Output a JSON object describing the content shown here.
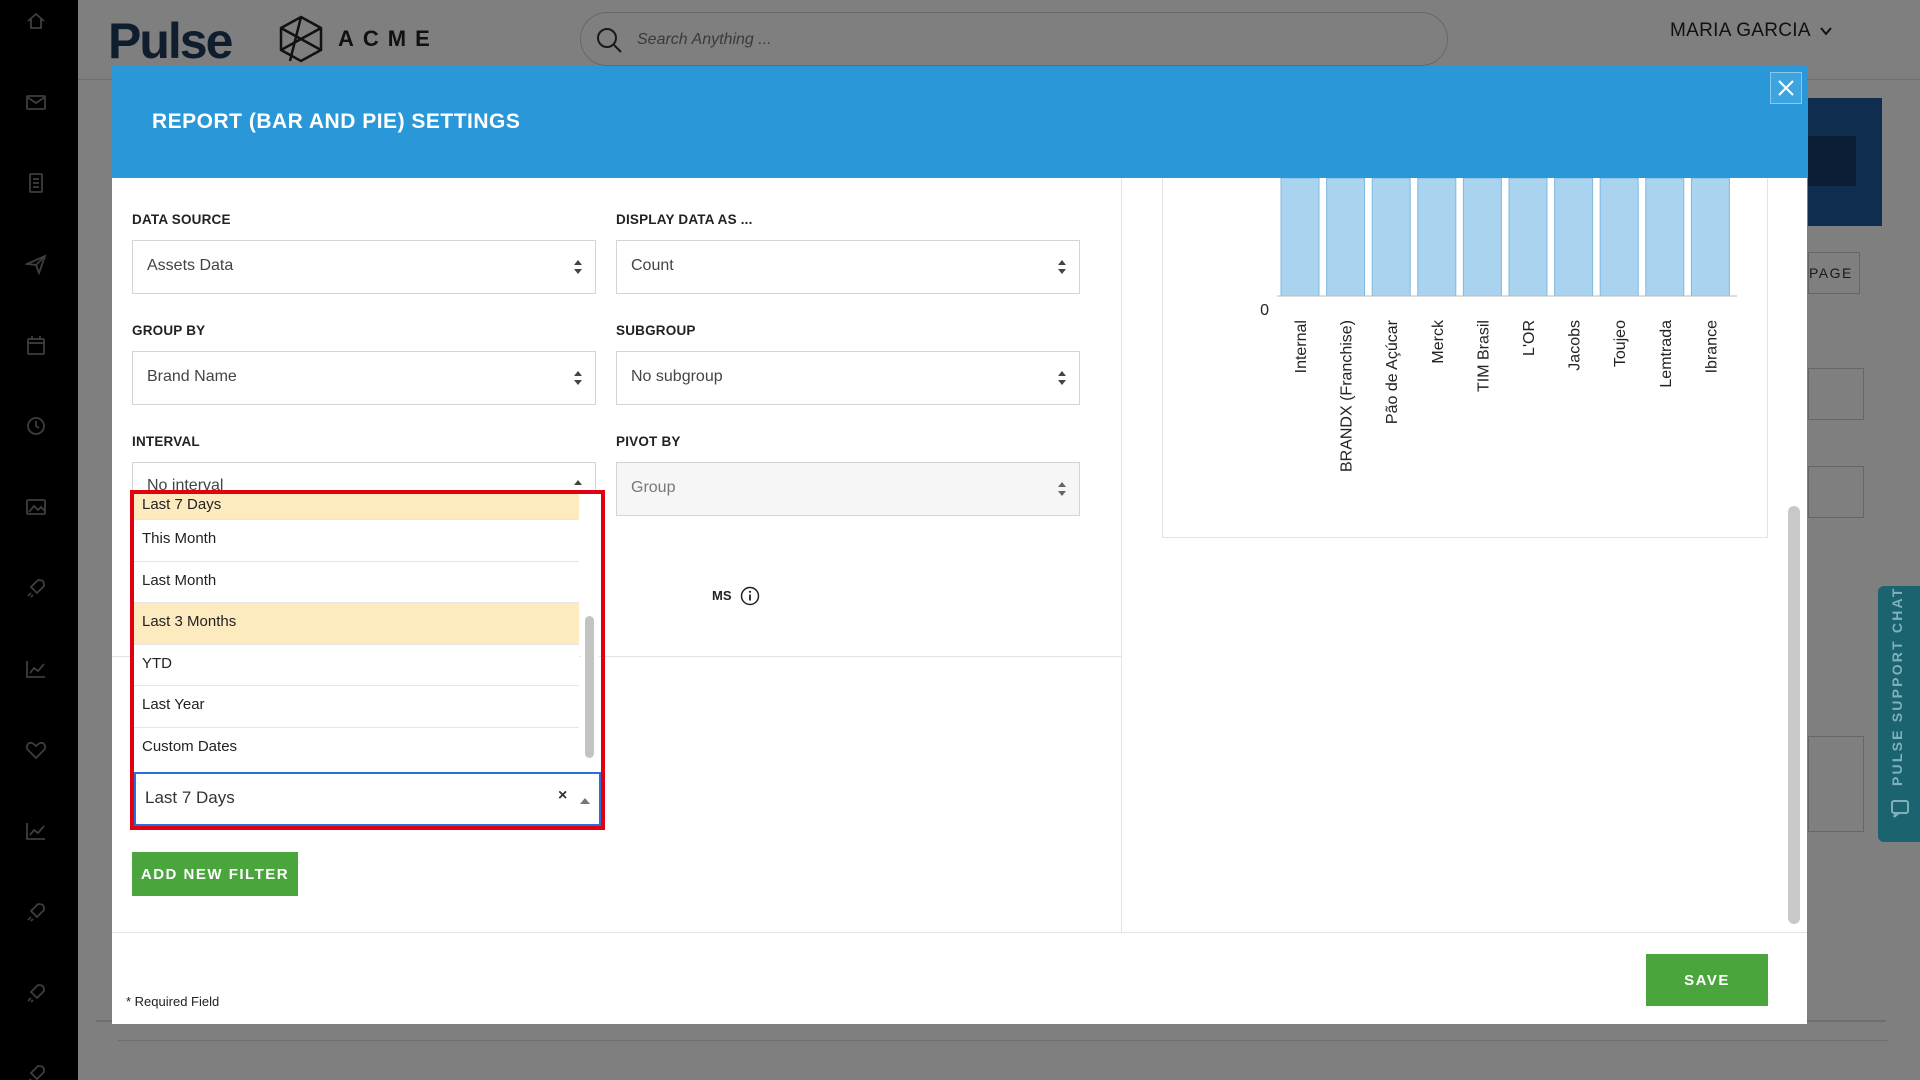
{
  "app": {
    "logo_text": "Pulse",
    "brand_text": "ACME",
    "search_placeholder": "Search Anything ...",
    "user_name": "MARIA GARCIA"
  },
  "rail_icons": [
    "home-icon",
    "mail-icon",
    "document-icon",
    "send-icon",
    "calendar-icon",
    "clock-icon",
    "image-icon",
    "rocket-icon",
    "chart-icon",
    "heart-icon",
    "chart-icon",
    "rocket-icon",
    "rocket-icon",
    "rocket-icon"
  ],
  "background": {
    "page_button_partial": "PAGE"
  },
  "support": {
    "label": "PULSE SUPPORT CHAT"
  },
  "modal": {
    "title": "REPORT (BAR AND PIE) SETTINGS",
    "fields": {
      "data_source": {
        "label": "DATA SOURCE",
        "value": "Assets Data"
      },
      "display_as": {
        "label": "DISPLAY DATA AS ...",
        "value": "Count"
      },
      "group_by": {
        "label": "GROUP BY",
        "value": "Brand Name"
      },
      "subgroup": {
        "label": "SUBGROUP",
        "value": "No subgroup"
      },
      "interval": {
        "label": "INTERVAL",
        "value_partial": "No interval"
      },
      "pivot_by": {
        "label": "PIVOT BY",
        "value": "Group"
      }
    },
    "partial_text": "MS",
    "dropdown": {
      "options": [
        {
          "label": "Last 7 Days",
          "highlighted": true
        },
        {
          "label": "This Month",
          "highlighted": false
        },
        {
          "label": "Last Month",
          "highlighted": false
        },
        {
          "label": "Last 3 Months",
          "highlighted": true
        },
        {
          "label": "YTD",
          "highlighted": false
        },
        {
          "label": "Last Year",
          "highlighted": false
        },
        {
          "label": "Custom Dates",
          "highlighted": false
        }
      ],
      "input_value": "Last 7 Days",
      "clear_symbol": "×"
    },
    "add_filter_label": "ADD NEW FILTER",
    "required_note": "* Required Field",
    "save_label": "SAVE"
  },
  "chart_data": {
    "type": "bar",
    "categories": [
      "Internal",
      "BRANDX (Franchise)",
      "Pão de Açúcar",
      "Merck",
      "TIM Brasil",
      "L'OR",
      "Jacobs",
      "Toujeo",
      "Lemtrada",
      "Ibrance"
    ],
    "y_tick_visible": "0",
    "bar_color": "#a9d3ee"
  }
}
